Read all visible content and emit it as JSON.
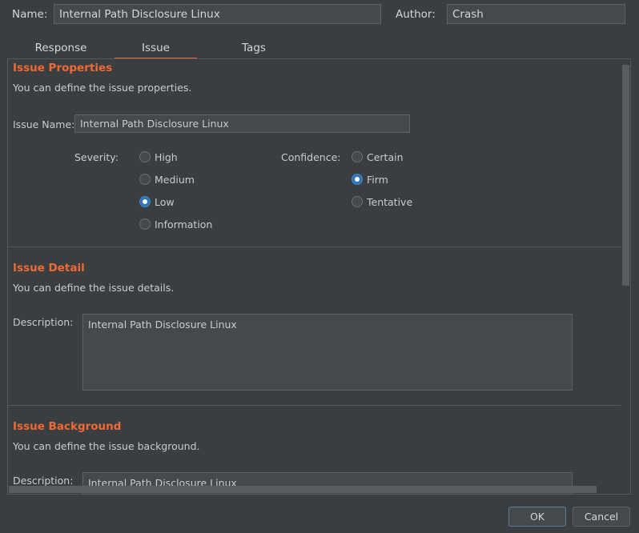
{
  "header": {
    "name_label": "Name:",
    "name_value": "Internal Path Disclosure Linux",
    "author_label": "Author:",
    "author_value": "Crash"
  },
  "tabs": [
    {
      "label": "Response",
      "active": false
    },
    {
      "label": "Issue",
      "active": true
    },
    {
      "label": "Tags",
      "active": false
    }
  ],
  "issue_properties": {
    "title": "Issue Properties",
    "description": "You can define the issue properties.",
    "issue_name_label": "Issue Name:",
    "issue_name_value": "Internal Path Disclosure Linux",
    "severity_label": "Severity:",
    "severity_options": [
      "High",
      "Medium",
      "Low",
      "Information"
    ],
    "severity_selected": "Low",
    "confidence_label": "Confidence:",
    "confidence_options": [
      "Certain",
      "Firm",
      "Tentative"
    ],
    "confidence_selected": "Firm"
  },
  "issue_detail": {
    "title": "Issue Detail",
    "description": "You can define the issue details.",
    "field_label": "Description:",
    "field_value": "Internal Path Disclosure Linux"
  },
  "issue_background": {
    "title": "Issue Background",
    "description": "You can define the issue background.",
    "field_label": "Description:",
    "field_value": "Internal Path Disclosure Linux"
  },
  "buttons": {
    "ok": "OK",
    "cancel": "Cancel"
  },
  "colors": {
    "background": "#3b3e41",
    "accent": "#ef6a35",
    "radio_selected": "#2e73b3"
  }
}
